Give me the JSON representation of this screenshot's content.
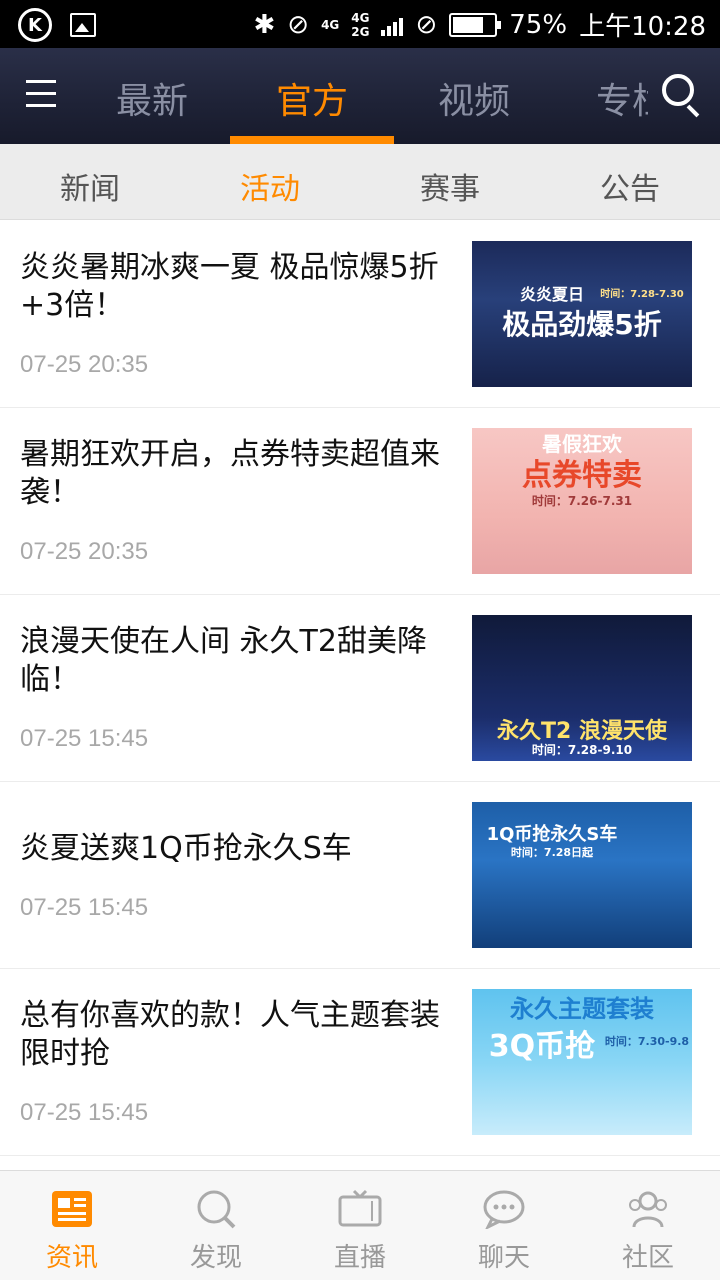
{
  "status_bar": {
    "network_top": "4G",
    "network_mid": "4G",
    "network_bot": "2G",
    "battery": "75%",
    "time": "上午10:28"
  },
  "top_tabs": [
    {
      "label": "最新"
    },
    {
      "label": "官方"
    },
    {
      "label": "视频"
    },
    {
      "label": "专栏"
    }
  ],
  "sub_tabs": [
    {
      "label": "新闻"
    },
    {
      "label": "活动"
    },
    {
      "label": "赛事"
    },
    {
      "label": "公告"
    }
  ],
  "articles": [
    {
      "title": "炎炎暑期冰爽一夏 极品惊爆5折+3倍！",
      "time": "07-25 20:35",
      "thumb_line1": "炎炎夏日",
      "thumb_date": "时间：7.28-7.30",
      "thumb_line2": "极品劲爆5折"
    },
    {
      "title": "暑期狂欢开启，点券特卖超值来袭！",
      "time": "07-25 20:35",
      "thumb_line1": "暑假狂欢",
      "thumb_line2": "点券特卖",
      "thumb_date": "时间：7.26-7.31"
    },
    {
      "title": "浪漫天使在人间 永久T2甜美降临！",
      "time": "07-25 15:45",
      "thumb_line1": "永久T2  浪漫天使",
      "thumb_date": "时间：7.28-9.10"
    },
    {
      "title": "炎夏送爽1Q币抢永久S车",
      "time": "07-25 15:45",
      "thumb_line1": "1Q币抢永久S车",
      "thumb_date": "时间：7.28日起"
    },
    {
      "title": "总有你喜欢的款！人气主题套装限时抢",
      "time": "07-25 15:45",
      "thumb_line1": "永久主题套装",
      "thumb_line2": "3Q币抢",
      "thumb_date": "时间：7.30-9.8"
    }
  ],
  "bottom_nav": [
    {
      "label": "资讯"
    },
    {
      "label": "发现"
    },
    {
      "label": "直播"
    },
    {
      "label": "聊天"
    },
    {
      "label": "社区"
    }
  ],
  "colors": {
    "accent": "#ff8a00",
    "inactive": "#999999"
  }
}
